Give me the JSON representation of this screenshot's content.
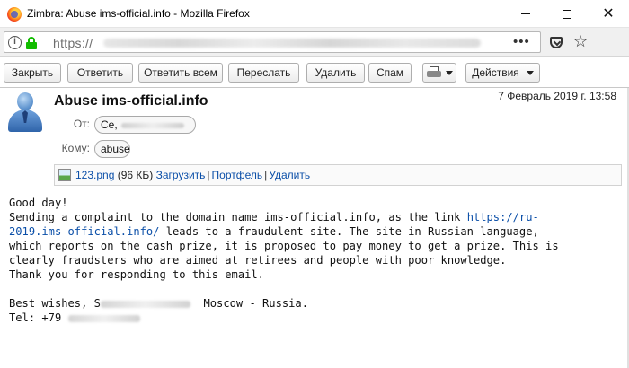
{
  "window": {
    "title": "Zimbra: Abuse ims-official.info - Mozilla Firefox"
  },
  "urlbar": {
    "url_prefix": "https://",
    "more_label": "•••"
  },
  "toolbar": {
    "close_label": "Закрыть",
    "reply_label": "Ответить",
    "reply_all_label": "Ответить всем",
    "forward_label": "Переслать",
    "delete_label": "Удалить",
    "spam_label": "Спам",
    "actions_label": "Действия"
  },
  "message": {
    "subject": "Abuse ims-official.info",
    "date": "7 Февраль 2019 г. 13:58",
    "from_label": "От:",
    "from_value": "Се,",
    "to_label": "Кому:",
    "to_value": "abuse"
  },
  "attachment": {
    "filename": "123.png",
    "size": "(96 КБ)",
    "download_label": "Загрузить",
    "briefcase_label": "Портфель",
    "delete_label": "Удалить"
  },
  "body": {
    "line1": "Good day!",
    "line2_pre": "Sending a complaint to the domain name ims-official.info, as the link ",
    "link_part1": "https://ru-",
    "link_part2": "2019.ims-official.info/",
    "line3_post": " leads to a fraudulent site. The site in Russian language,",
    "line4": "which reports on the cash prize, it is proposed to pay money to get a prize. This is",
    "line5": "clearly fraudsters who are aimed at retirees and people with poor knowledge.",
    "line6": "Thank you for responding to this email.",
    "line7_pre": "Best wishes, S",
    "line7_post": "Moscow - Russia.",
    "line8": "Tel: +79"
  }
}
